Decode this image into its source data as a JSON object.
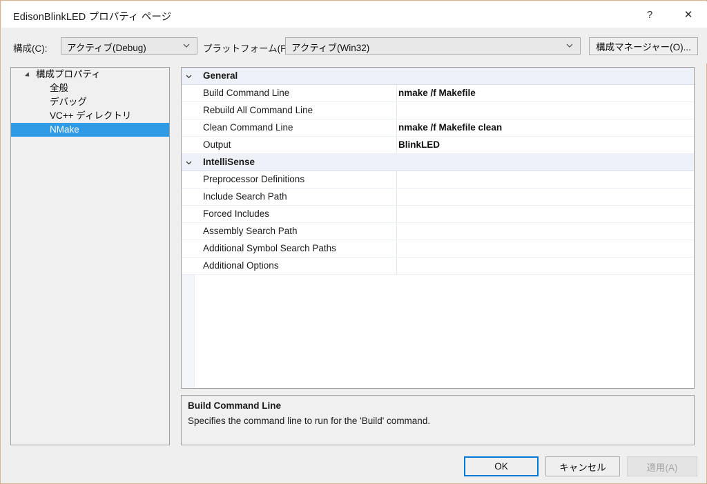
{
  "window": {
    "title": "EdisonBlinkLED プロパティ ページ",
    "help_glyph": "?",
    "close_glyph": "✕"
  },
  "toolbar": {
    "configuration_label": "構成(C):",
    "configuration_value": "アクティブ(Debug)",
    "platform_label": "プラットフォーム(P):",
    "platform_value": "アクティブ(Win32)",
    "config_manager_label": "構成マネージャー(O)..."
  },
  "tree": {
    "root": "構成プロパティ",
    "items": [
      {
        "label": "全般",
        "selected": false
      },
      {
        "label": "デバッグ",
        "selected": false
      },
      {
        "label": "VC++ ディレクトリ",
        "selected": false
      },
      {
        "label": "NMake",
        "selected": true
      }
    ]
  },
  "grid": {
    "groups": [
      {
        "name": "General",
        "expanded": true,
        "rows": [
          {
            "name": "Build Command Line",
            "value": "nmake /f Makefile"
          },
          {
            "name": "Rebuild All Command Line",
            "value": ""
          },
          {
            "name": "Clean Command Line",
            "value": "nmake /f Makefile clean"
          },
          {
            "name": "Output",
            "value": "BlinkLED"
          }
        ]
      },
      {
        "name": "IntelliSense",
        "expanded": true,
        "rows": [
          {
            "name": "Preprocessor Definitions",
            "value": ""
          },
          {
            "name": "Include Search Path",
            "value": ""
          },
          {
            "name": "Forced Includes",
            "value": ""
          },
          {
            "name": "Assembly Search Path",
            "value": ""
          },
          {
            "name": "Additional Symbol Search Paths",
            "value": ""
          },
          {
            "name": "Additional Options",
            "value": ""
          }
        ]
      }
    ]
  },
  "help": {
    "title": "Build Command Line",
    "body": "Specifies the command line to run for the 'Build' command."
  },
  "footer": {
    "ok_label": "OK",
    "cancel_label": "キャンセル",
    "apply_label": "適用(A)"
  },
  "colors": {
    "selection": "#2f9ae5",
    "focus_border": "#0078d7",
    "category_row": "#eef1f7",
    "window_border": "#d9b38c"
  }
}
